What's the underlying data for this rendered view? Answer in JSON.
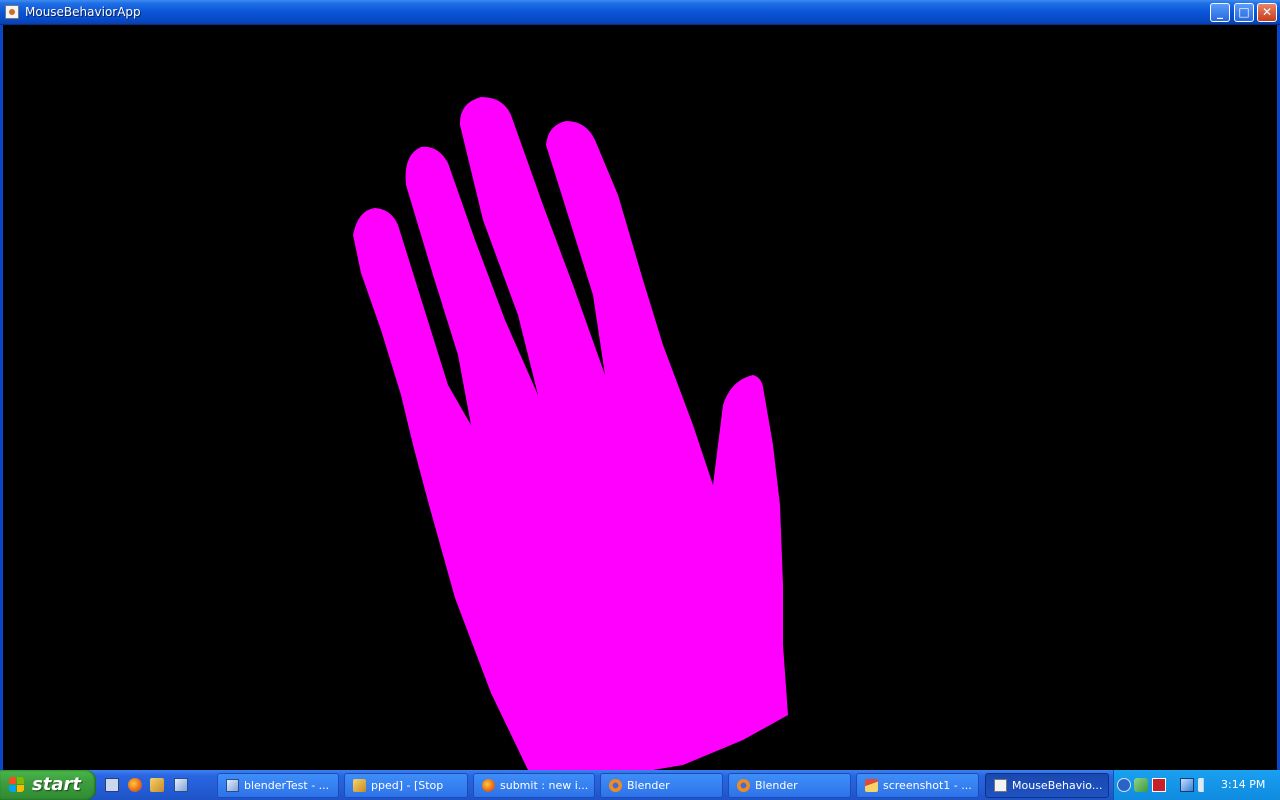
{
  "window": {
    "title": "MouseBehaviorApp",
    "controls": {
      "minimize": "_",
      "maximize": "□",
      "close": "✕"
    }
  },
  "canvas": {
    "background": "#000000",
    "hand_color": "#ff00ff"
  },
  "taskbar": {
    "start_label": "start",
    "quick_launch": [
      "show-desktop-icon",
      "firefox-icon",
      "paint-icon",
      "app-cube-icon"
    ],
    "tasks": [
      {
        "label": "blenderTest - ...",
        "icon": "cube-icon",
        "active": false
      },
      {
        "label": "pped] -    [Stop",
        "icon": "paint-icon",
        "active": false
      },
      {
        "label": "submit : new i...",
        "icon": "firefox-icon",
        "active": false
      },
      {
        "label": "Blender",
        "icon": "blender-icon",
        "active": false
      },
      {
        "label": "Blender",
        "icon": "blender-icon",
        "active": false
      },
      {
        "label": "screenshot1 - ...",
        "icon": "paint-brush-icon",
        "active": false
      },
      {
        "label": "MouseBehavio...",
        "icon": "java-icon",
        "active": true
      }
    ],
    "tray": {
      "clock": "3:14 PM"
    }
  }
}
